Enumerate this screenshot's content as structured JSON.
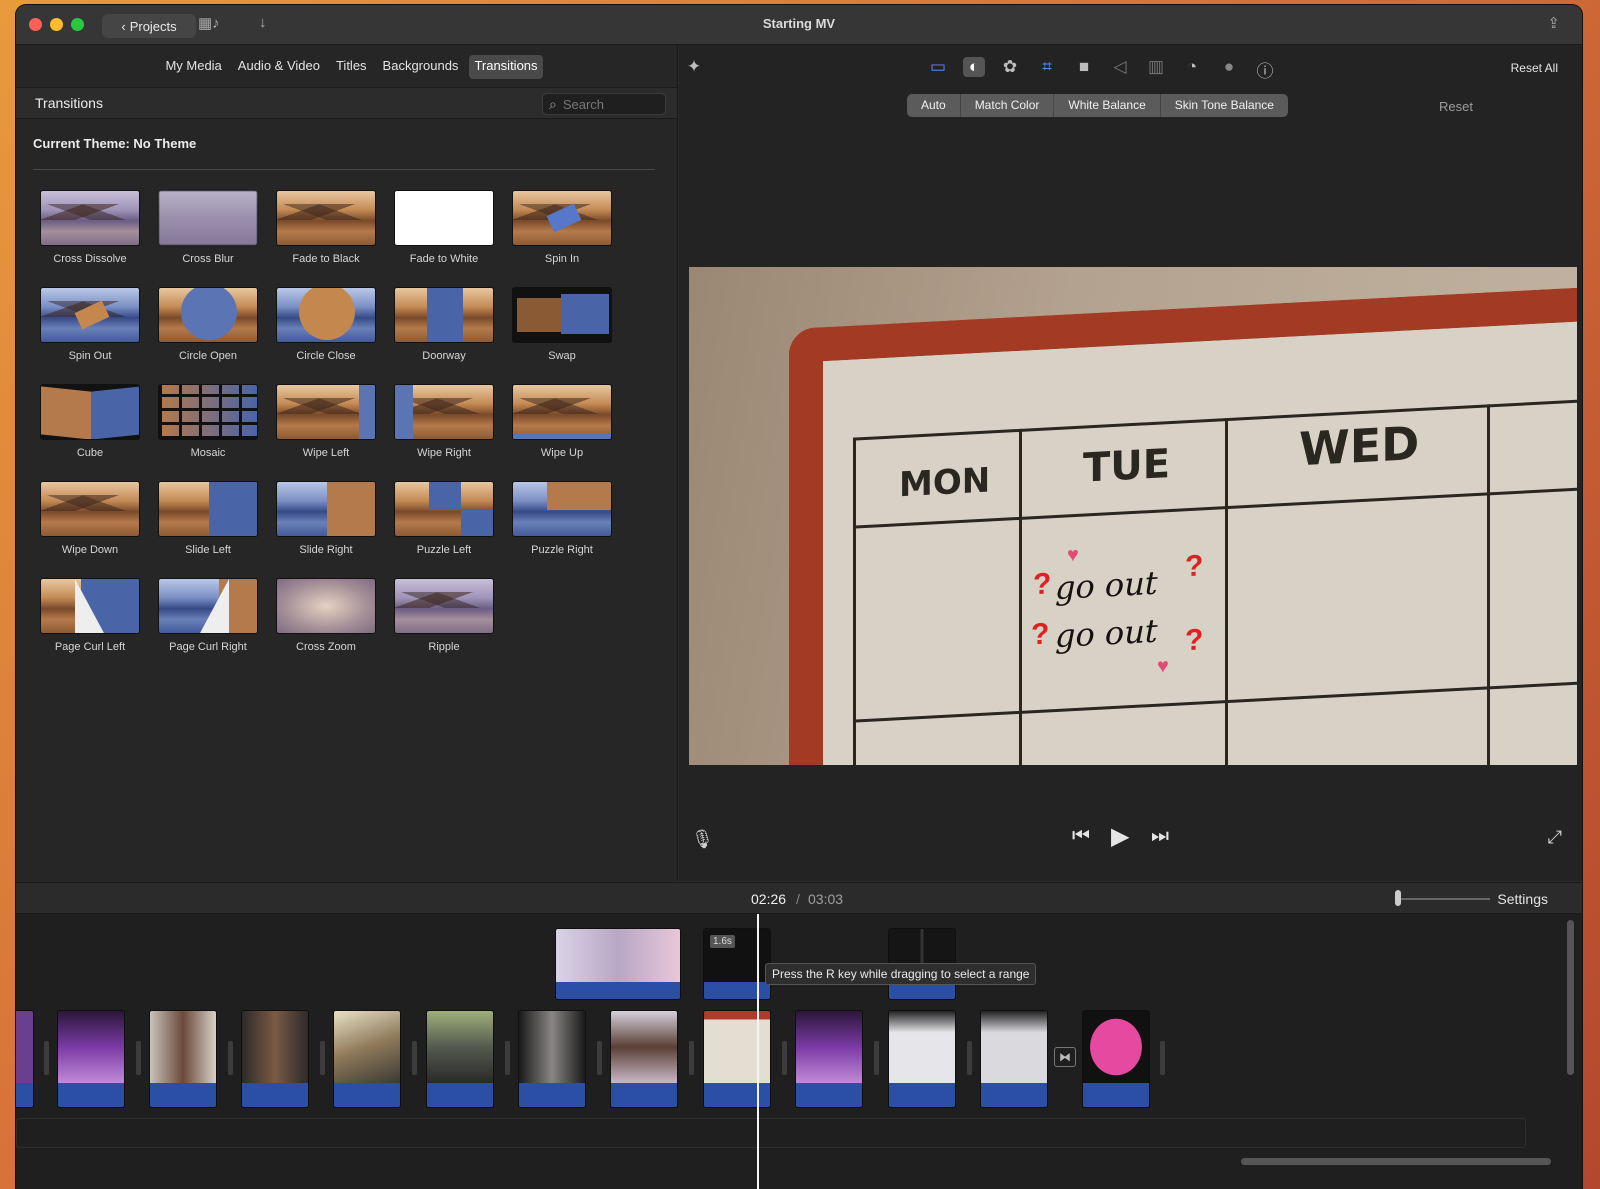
{
  "window": {
    "title": "Starting MV"
  },
  "titlebar": {
    "projects_label": "Projects"
  },
  "library": {
    "tabs": [
      {
        "label": "My Media"
      },
      {
        "label": "Audio & Video"
      },
      {
        "label": "Titles"
      },
      {
        "label": "Backgrounds"
      },
      {
        "label": "Transitions",
        "active": true
      }
    ],
    "section_title": "Transitions",
    "search_placeholder": "Search",
    "theme_label": "Current Theme: No Theme"
  },
  "transitions": [
    {
      "label": "Cross Dissolve"
    },
    {
      "label": "Cross Blur"
    },
    {
      "label": "Fade to Black"
    },
    {
      "label": "Fade to White"
    },
    {
      "label": "Spin In"
    },
    {
      "label": "Spin Out"
    },
    {
      "label": "Circle Open"
    },
    {
      "label": "Circle Close"
    },
    {
      "label": "Doorway"
    },
    {
      "label": "Swap"
    },
    {
      "label": "Cube"
    },
    {
      "label": "Mosaic"
    },
    {
      "label": "Wipe Left"
    },
    {
      "label": "Wipe Right"
    },
    {
      "label": "Wipe Up"
    },
    {
      "label": "Wipe Down"
    },
    {
      "label": "Slide Left"
    },
    {
      "label": "Slide Right"
    },
    {
      "label": "Puzzle Left"
    },
    {
      "label": "Puzzle Right"
    },
    {
      "label": "Page Curl Left"
    },
    {
      "label": "Page Curl Right"
    },
    {
      "label": "Cross Zoom"
    },
    {
      "label": "Ripple"
    }
  ],
  "viewer": {
    "reset_all": "Reset All",
    "color_buttons": [
      {
        "label": "Auto"
      },
      {
        "label": "Match Color"
      },
      {
        "label": "White Balance"
      },
      {
        "label": "Skin Tone Balance"
      }
    ],
    "reset": "Reset",
    "frame": {
      "days": [
        "MON",
        "TUE",
        "WED"
      ],
      "handwriting": [
        "go out",
        "go out"
      ]
    }
  },
  "timeline": {
    "current_time": "02:26",
    "separator": "/",
    "total_time": "03:03",
    "settings": "Settings",
    "tooltip": "Press the R key while dragging to select a range",
    "duration_badge": "1.6s"
  }
}
